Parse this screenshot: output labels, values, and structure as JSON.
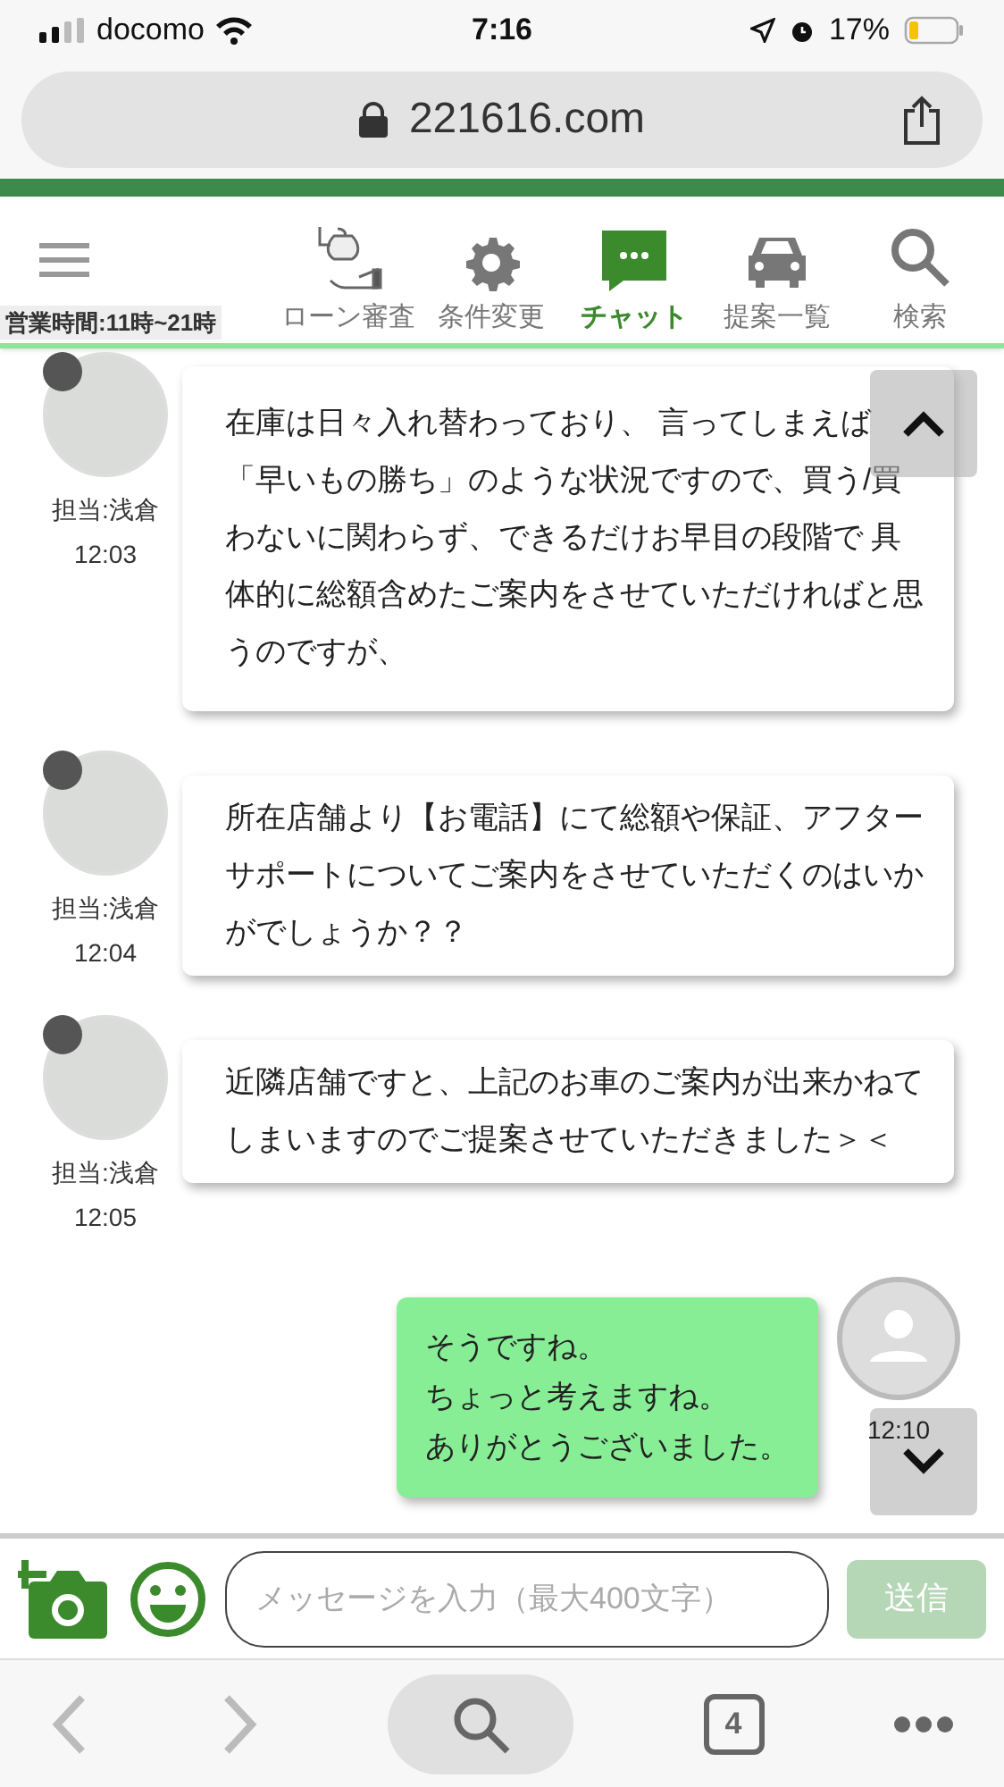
{
  "status_bar": {
    "carrier": "docomo",
    "time": "7:16",
    "battery": "17%"
  },
  "browser": {
    "url": "221616.com",
    "tabs_count": "4"
  },
  "header": {
    "business_hours": "営業時間:11時~21時",
    "nav": [
      {
        "label": "ローン審査",
        "selected": false
      },
      {
        "label": "条件変更",
        "selected": false
      },
      {
        "label": "チャット",
        "selected": true
      },
      {
        "label": "提案一覧",
        "selected": false
      },
      {
        "label": "検索",
        "selected": false
      }
    ]
  },
  "messages": [
    {
      "kind": "agent",
      "sender": "担当:浅倉",
      "time": "12:03",
      "lines": [
        "在庫は日々入れ替わっており、 言ってしまえば「早いもの勝ち」のような状況ですので、買う/買わないに関わらず、できるだけお早目の段階で 具体的に総額含めたご案内をさせていただければと思うのですが、"
      ]
    },
    {
      "kind": "agent",
      "sender": "担当:浅倉",
      "time": "12:04",
      "lines": [
        "所在店舗より【お電話】にて総額や保証、アフターサポートについてご案内をさせていただくのはいかがでしょうか？？"
      ]
    },
    {
      "kind": "agent",
      "sender": "担当:浅倉",
      "time": "12:05",
      "lines": [
        "近隣店舗ですと、上記のお車のご案内が出来かねてしまいますのでご提案させていただきました＞＜"
      ]
    },
    {
      "kind": "user",
      "time": "12:10",
      "lines": [
        "そうですね。",
        "ちょっと考えますね。",
        "ありがとうございました。"
      ]
    }
  ],
  "composer": {
    "placeholder": "メッセージを入力（最大400文字）",
    "send": "送信"
  }
}
